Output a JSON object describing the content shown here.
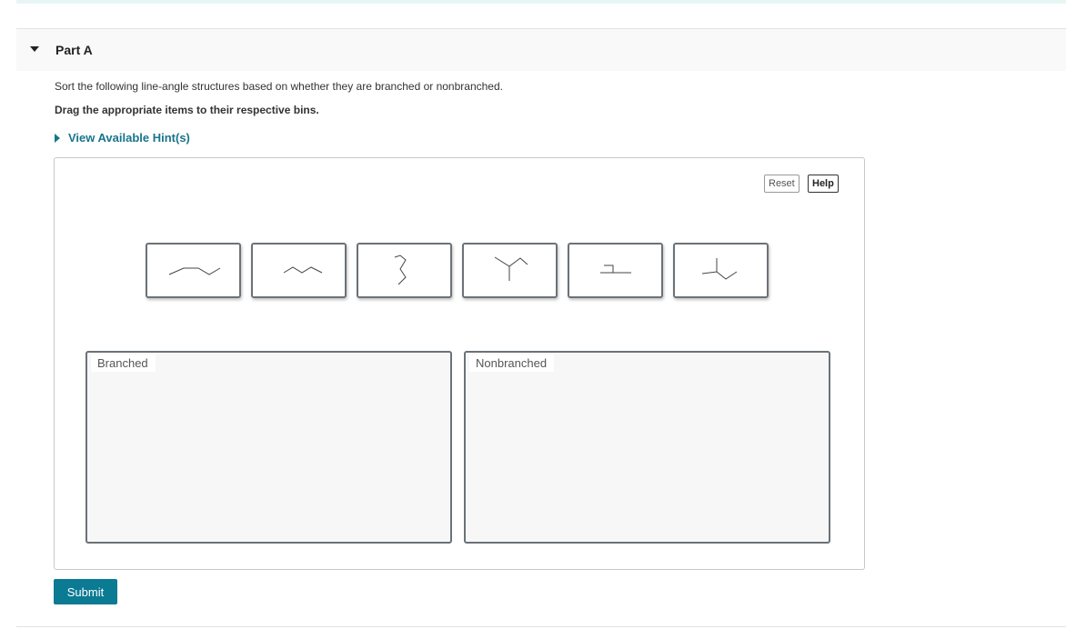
{
  "part": {
    "title": "Part A",
    "caret_icon": "caret-down-icon"
  },
  "question": {
    "instruction": "Sort the following line-angle structures based on whether they are branched or nonbranched.",
    "directive": "Drag the appropriate items to their respective bins.",
    "hint_label": "View Available Hint(s)",
    "hint_icon": "caret-right-icon"
  },
  "workspace": {
    "reset_label": "Reset",
    "help_label": "Help",
    "tiles": [
      {
        "icon": "pentane-structure-icon"
      },
      {
        "icon": "hexane-zigzag-structure-icon"
      },
      {
        "icon": "vertical-zigzag-structure-icon"
      },
      {
        "icon": "y-branched-structure-icon"
      },
      {
        "icon": "t-shaped-structure-icon"
      },
      {
        "icon": "forked-branched-structure-icon"
      }
    ],
    "bins": [
      {
        "label": "Branched"
      },
      {
        "label": "Nonbranched"
      }
    ]
  },
  "actions": {
    "submit_label": "Submit"
  },
  "colors": {
    "accent": "#18758c",
    "submit_bg": "#0b7a93",
    "bin_bg": "#f7f7f7",
    "tile_border": "#6b7278"
  }
}
